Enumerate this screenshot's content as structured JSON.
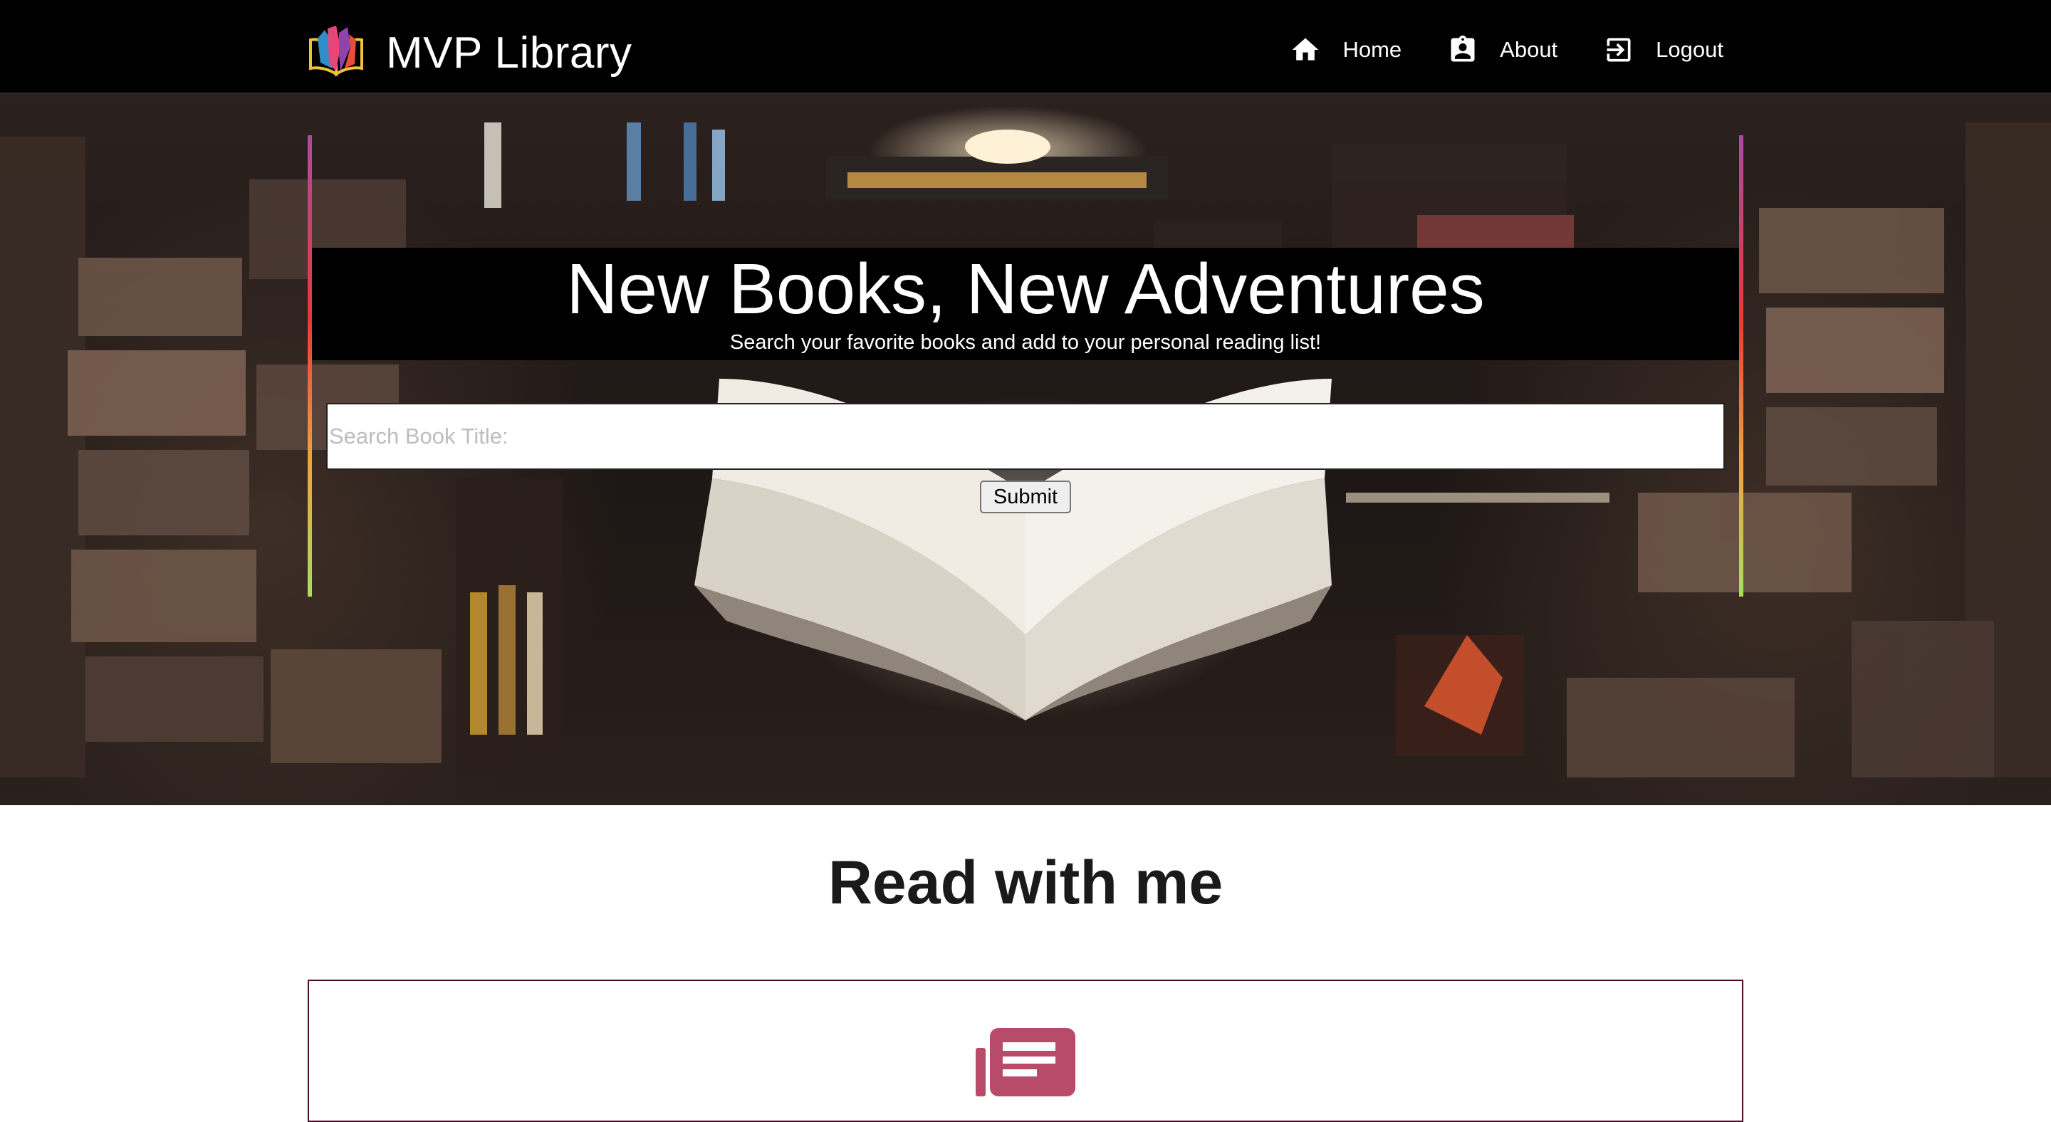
{
  "navbar": {
    "brand_title": "MVP Library",
    "links": [
      {
        "label": "Home",
        "icon": "home-icon"
      },
      {
        "label": "About",
        "icon": "contact-card-icon"
      },
      {
        "label": "Logout",
        "icon": "logout-icon"
      }
    ]
  },
  "hero": {
    "title": "New Books, New Adventures",
    "subtitle": "Search your favorite books and add to your personal reading list!",
    "search": {
      "placeholder": "Search Book Title:",
      "value": ""
    },
    "submit_label": "Submit"
  },
  "main": {
    "section_title": "Read with me",
    "card": {
      "icon": "newspaper-icon"
    }
  },
  "colors": {
    "navbar_bg": "#000000",
    "accent": "#b84a6a",
    "card_border": "#4a0f26",
    "frame_gradient": [
      "#b04aa0",
      "#e63a3a",
      "#f2a33a",
      "#a8e05a"
    ]
  }
}
